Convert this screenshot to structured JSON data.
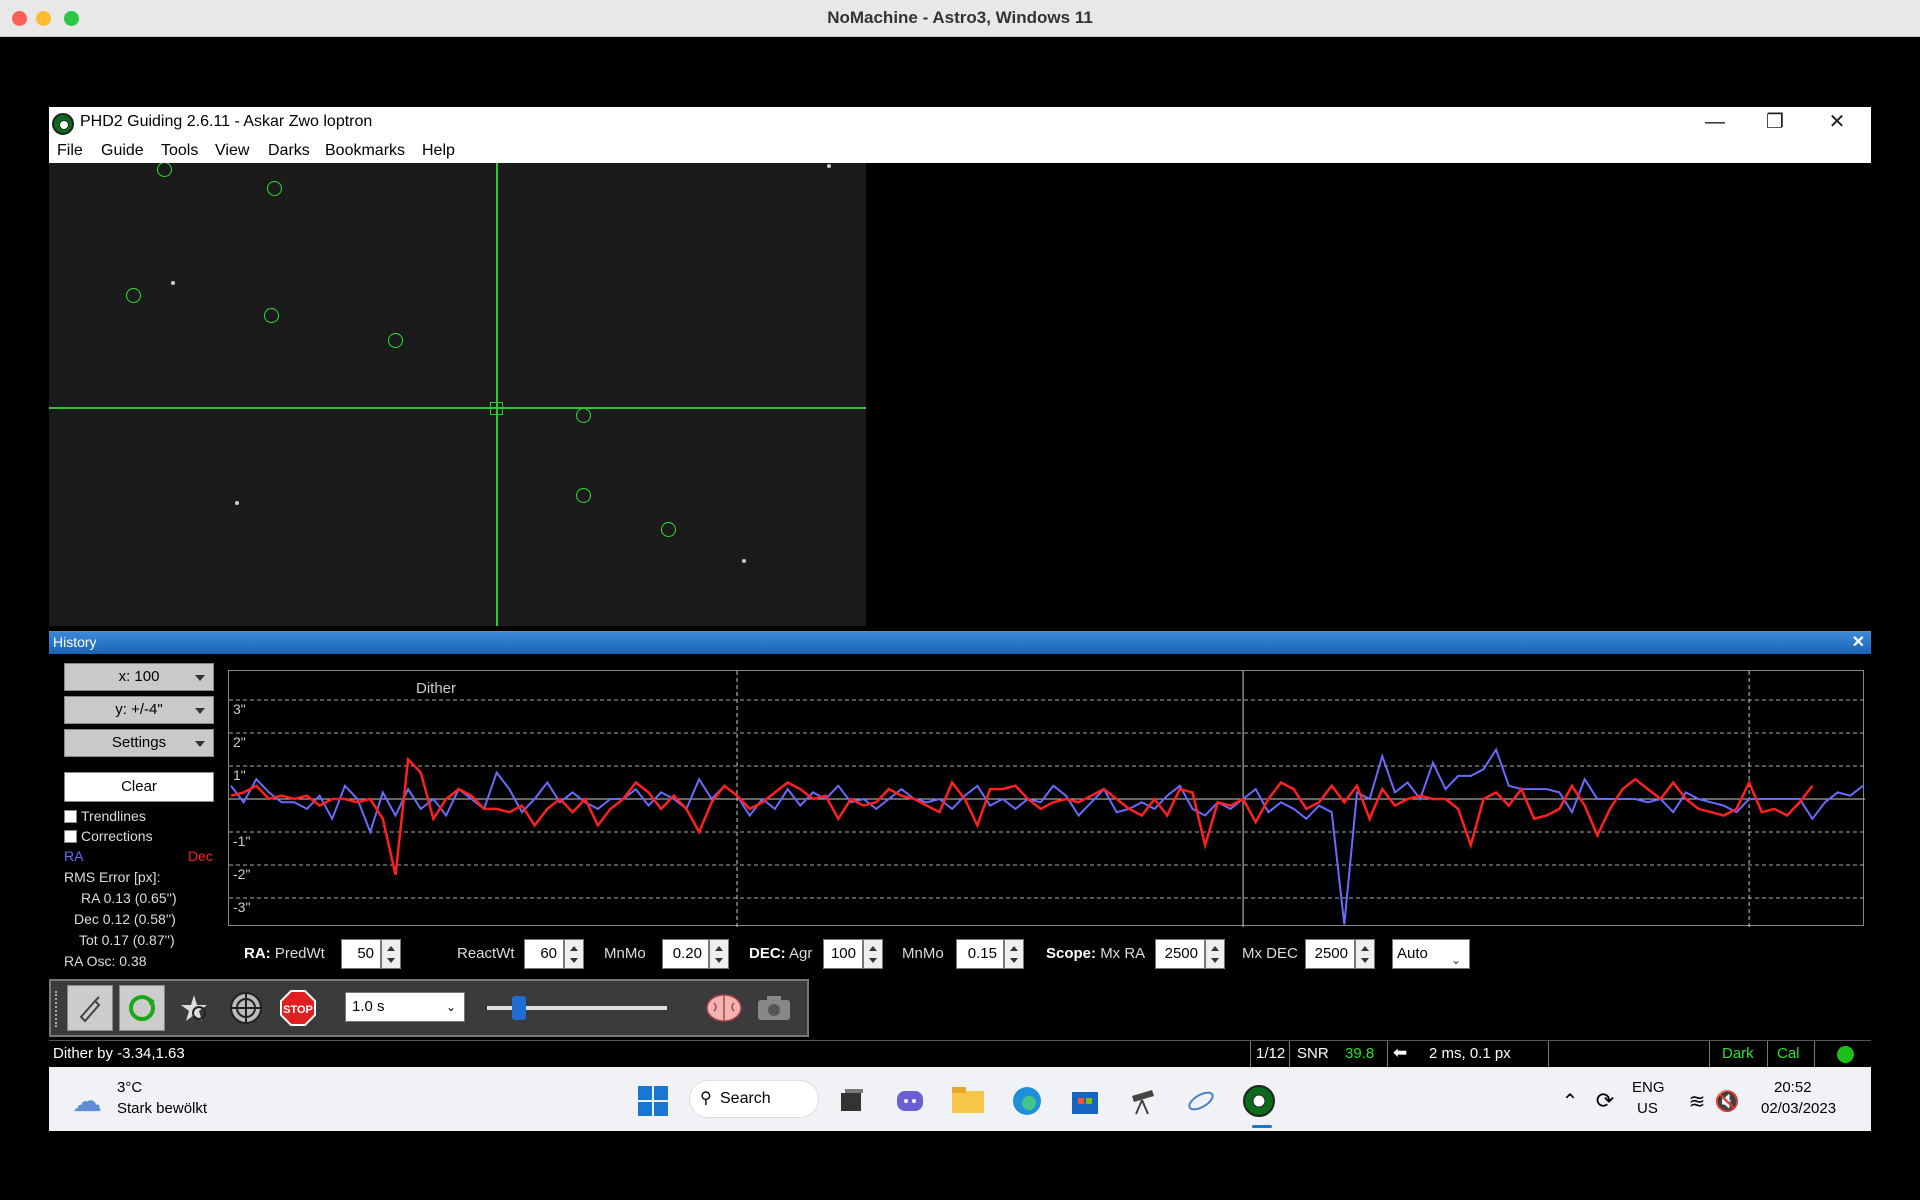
{
  "mac": {
    "title": "NoMachine - Astro3, Windows 11"
  },
  "phd": {
    "title": "PHD2 Guiding 2.6.11 - Askar Zwo loptron",
    "menu": [
      "File",
      "Guide",
      "Tools",
      "View",
      "Darks",
      "Bookmarks",
      "Help"
    ]
  },
  "history": {
    "title": "History",
    "x_scale": "x: 100",
    "y_scale": "y: +/-4\"",
    "settings": "Settings",
    "clear": "Clear",
    "trendlines": "Trendlines",
    "corrections": "Corrections",
    "ra_label": "RA",
    "dec_label": "Dec",
    "rms_title": "RMS Error [px]:",
    "rms_ra": "RA  0.13 (0.65'')",
    "rms_dec": "Dec  0.12 (0.58'')",
    "rms_tot": "Tot  0.17 (0.87'')",
    "ra_osc": "RA Osc: 0.38",
    "dither_label": "Dither",
    "y_ticks": [
      "3\"",
      "2\"",
      "1\"",
      "-1\"",
      "-2\"",
      "-3\""
    ]
  },
  "params": {
    "ra_head": "RA:",
    "predwt_label": "PredWt",
    "predwt": "50",
    "reactwt_label": "ReactWt",
    "reactwt": "60",
    "mnmo_ra_label": "MnMo",
    "mnmo_ra": "0.20",
    "dec_head": "DEC:",
    "agr_label": "Agr",
    "agr": "100",
    "mnmo_dec_label": "MnMo",
    "mnmo_dec": "0.15",
    "scope_head": "Scope:",
    "mxra_label": "Mx RA",
    "mxra": "2500",
    "mxdec_label": "Mx DEC",
    "mxdec": "2500",
    "mode": "Auto"
  },
  "toolbar": {
    "exposure": "1.0 s"
  },
  "status": {
    "message": "Dither by -3.34,1.63",
    "frame": "1/12",
    "snr_label": "SNR",
    "snr": "39.8",
    "guide": "2 ms, 0.1 px",
    "dark": "Dark",
    "cal": "Cal"
  },
  "taskbar": {
    "temp": "3°C",
    "weather": "Stark bewölkt",
    "search": "Search",
    "lang1": "ENG",
    "lang2": "US",
    "time": "20:52",
    "date": "02/03/2023"
  },
  "chart_data": {
    "type": "line",
    "ylim": [
      -4,
      4
    ],
    "series": [
      {
        "name": "RA",
        "color": "#6a6aff",
        "values": [
          0.4,
          -0.1,
          0.6,
          0.2,
          -0.1,
          -0.1,
          -0.3,
          0.1,
          -0.6,
          0.4,
          0.0,
          -1.0,
          0.2,
          -0.5,
          0.3,
          -0.3,
          0.0,
          -0.5,
          0.3,
          0.0,
          -0.3,
          0.8,
          0.3,
          -0.4,
          0.0,
          0.5,
          -0.1,
          0.2,
          -0.1,
          -0.3,
          0.0,
          0.0,
          0.3,
          -0.2,
          0.2,
          0.0,
          -0.3,
          0.6,
          0.0,
          0.4,
          0.1,
          -0.5,
          0.0,
          -0.3,
          0.3,
          -0.2,
          0.2,
          0.0,
          0.4,
          -0.1,
          0.0,
          -0.3,
          0.0,
          0.3,
          0.0,
          -0.1,
          0.0,
          -0.3,
          0.1,
          0.4,
          -0.2,
          0.0,
          -0.3,
          0.0,
          -0.1,
          0.4,
          0.1,
          -0.5,
          -0.1,
          0.3,
          -0.4,
          -0.3,
          -0.1,
          -0.3,
          0.1,
          0.4,
          -0.3,
          -0.5,
          -0.1,
          -0.3,
          0.0,
          0.3,
          -0.4,
          -0.1,
          -0.3,
          -0.6,
          -0.2,
          -0.4,
          -3.8,
          0.2,
          0.0,
          1.3,
          0.2,
          0.5,
          0.0,
          1.1,
          0.3,
          0.7,
          0.7,
          0.9,
          1.5,
          0.4,
          0.3,
          0.3,
          0.3,
          0.2,
          -0.4,
          0.6,
          0.0,
          0.0,
          0.0,
          0.0,
          -0.1,
          0.0,
          -0.4,
          0.2,
          0.0,
          -0.1,
          -0.2,
          -0.4,
          0.0,
          0.0,
          0.0,
          0.0,
          0.0,
          -0.6,
          -0.1,
          0.2,
          0.1,
          0.4
        ]
      },
      {
        "name": "Dec",
        "color": "#ff2020",
        "values": [
          0.1,
          0.2,
          0.4,
          0.0,
          0.1,
          0.0,
          0.1,
          -0.2,
          0.0,
          0.0,
          -0.1,
          0.0,
          -0.6,
          -2.3,
          1.2,
          0.8,
          -0.6,
          0.0,
          0.3,
          0.1,
          -0.3,
          -0.3,
          -0.4,
          -0.2,
          -0.8,
          -0.3,
          0.0,
          -0.4,
          0.0,
          -0.8,
          -0.3,
          0.0,
          0.5,
          0.2,
          -0.3,
          0.1,
          -0.3,
          -1.0,
          -0.1,
          0.4,
          0.1,
          -0.3,
          -0.1,
          0.2,
          0.5,
          0.3,
          0.0,
          0.1,
          -0.6,
          0.0,
          -0.2,
          -0.1,
          0.3,
          0.1,
          0.0,
          -0.2,
          -0.4,
          0.5,
          0.0,
          -0.8,
          0.3,
          0.3,
          0.4,
          0.0,
          -0.3,
          -0.1,
          0.0,
          -0.1,
          0.1,
          0.3,
          0.0,
          -0.3,
          -0.5,
          0.0,
          -0.5,
          0.3,
          0.2,
          -1.4,
          -0.1,
          -0.2,
          0.0,
          -0.7,
          0.0,
          0.5,
          0.3,
          -0.3,
          -0.1,
          0.4,
          -0.1,
          0.4,
          -0.6,
          0.3,
          -0.2,
          0.0,
          0.1,
          0.0,
          0.0,
          -0.3,
          -1.4,
          0.0,
          0.2,
          -0.2,
          0.3,
          -0.6,
          -0.5,
          -0.3,
          0.4,
          -0.2,
          -1.1,
          -0.3,
          0.3,
          0.6,
          0.3,
          0.0,
          0.5,
          0.0,
          -0.3,
          -0.4,
          -0.5,
          -0.3,
          0.5,
          -0.4,
          -0.3,
          -0.5,
          -0.1,
          0.4
        ]
      }
    ],
    "dither_markers": [
      40,
      80,
      120
    ]
  }
}
